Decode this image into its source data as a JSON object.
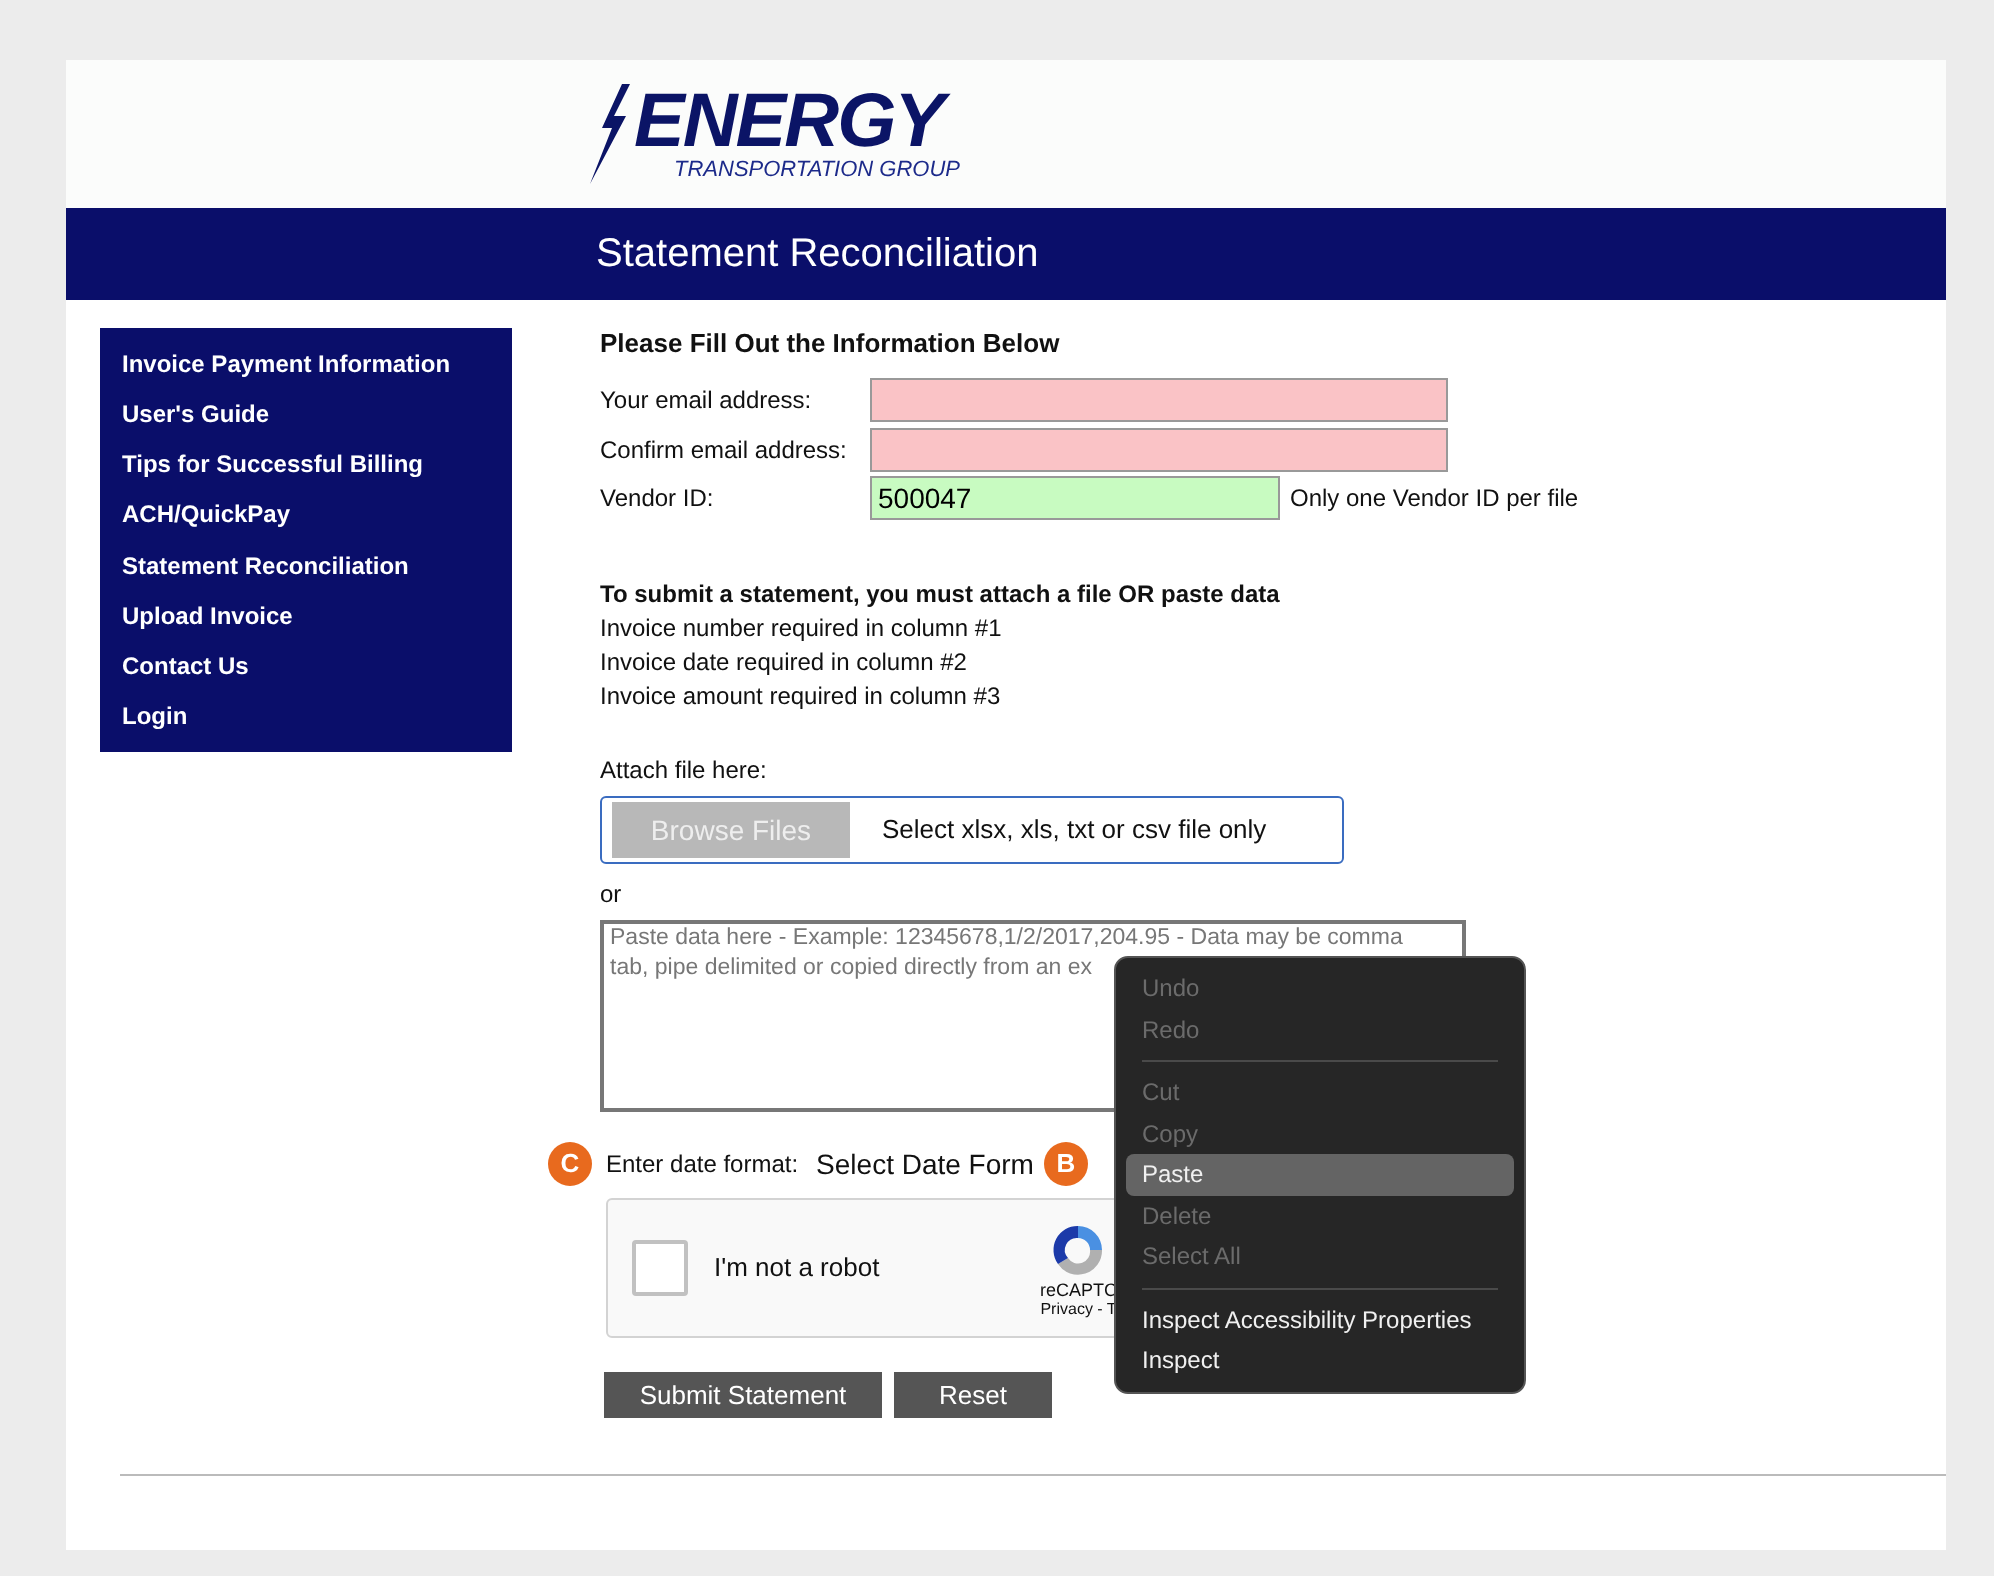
{
  "logo": {
    "name": "ENERGY",
    "tagline": "TRANSPORTATION GROUP"
  },
  "page_title": "Statement Reconciliation",
  "sidebar": {
    "items": [
      {
        "label": "Invoice Payment Information"
      },
      {
        "label": "User's Guide"
      },
      {
        "label": "Tips for Successful Billing"
      },
      {
        "label": "ACH/QuickPay"
      },
      {
        "label": "Statement Reconciliation"
      },
      {
        "label": "Upload Invoice"
      },
      {
        "label": "Contact Us"
      },
      {
        "label": "Login"
      }
    ]
  },
  "form": {
    "heading": "Please Fill Out the Information Below",
    "fields": [
      {
        "label": "Your email address:",
        "valid": false
      },
      {
        "label": "Confirm email address:",
        "valid": false
      },
      {
        "label": "Vendor ID:",
        "value": "500047",
        "valid": true,
        "note": "Only one Vendor ID per file"
      }
    ],
    "instructions_title": "To submit a statement, you must attach a file OR paste data",
    "instructions": [
      "Invoice number required in column #1",
      "Invoice date required in column #2",
      "Invoice amount required in column #3"
    ],
    "attach_label": "Attach file here:",
    "browse_button": "Browse Files",
    "file_hint": "Select xlsx, xls, txt or csv file only",
    "or_label": "or",
    "paste_placeholder": [
      "Paste data here - Example: 12345678,1/2/2017,204.95 - Data may be comma",
      "tab, pipe delimited or copied directly from an ex"
    ],
    "date_label": "Enter date format:",
    "date_select": "Select Date Form",
    "captcha": {
      "label": "I'm not a robot",
      "checked": false,
      "brand": "reCAPTC",
      "links": "Privacy - T"
    },
    "buttons": [
      "Submit Statement",
      "Reset"
    ]
  },
  "badges": [
    {
      "label": "C"
    },
    {
      "label": "B"
    }
  ],
  "context_menu": [
    {
      "label": "Undo",
      "disabled": true,
      "selected": false
    },
    {
      "label": "Redo",
      "disabled": true,
      "selected": false,
      "divider_after": true
    },
    {
      "label": "Cut",
      "disabled": true,
      "selected": false
    },
    {
      "label": "Copy",
      "disabled": true,
      "selected": false
    },
    {
      "label": "Paste",
      "disabled": false,
      "selected": true
    },
    {
      "label": "Delete",
      "disabled": true,
      "selected": false
    },
    {
      "label": "Select All",
      "disabled": true,
      "selected": false,
      "divider_after": true
    },
    {
      "label": "Inspect Accessibility Properties",
      "disabled": false,
      "selected": false
    },
    {
      "label": "Inspect",
      "disabled": false,
      "selected": false
    }
  ]
}
